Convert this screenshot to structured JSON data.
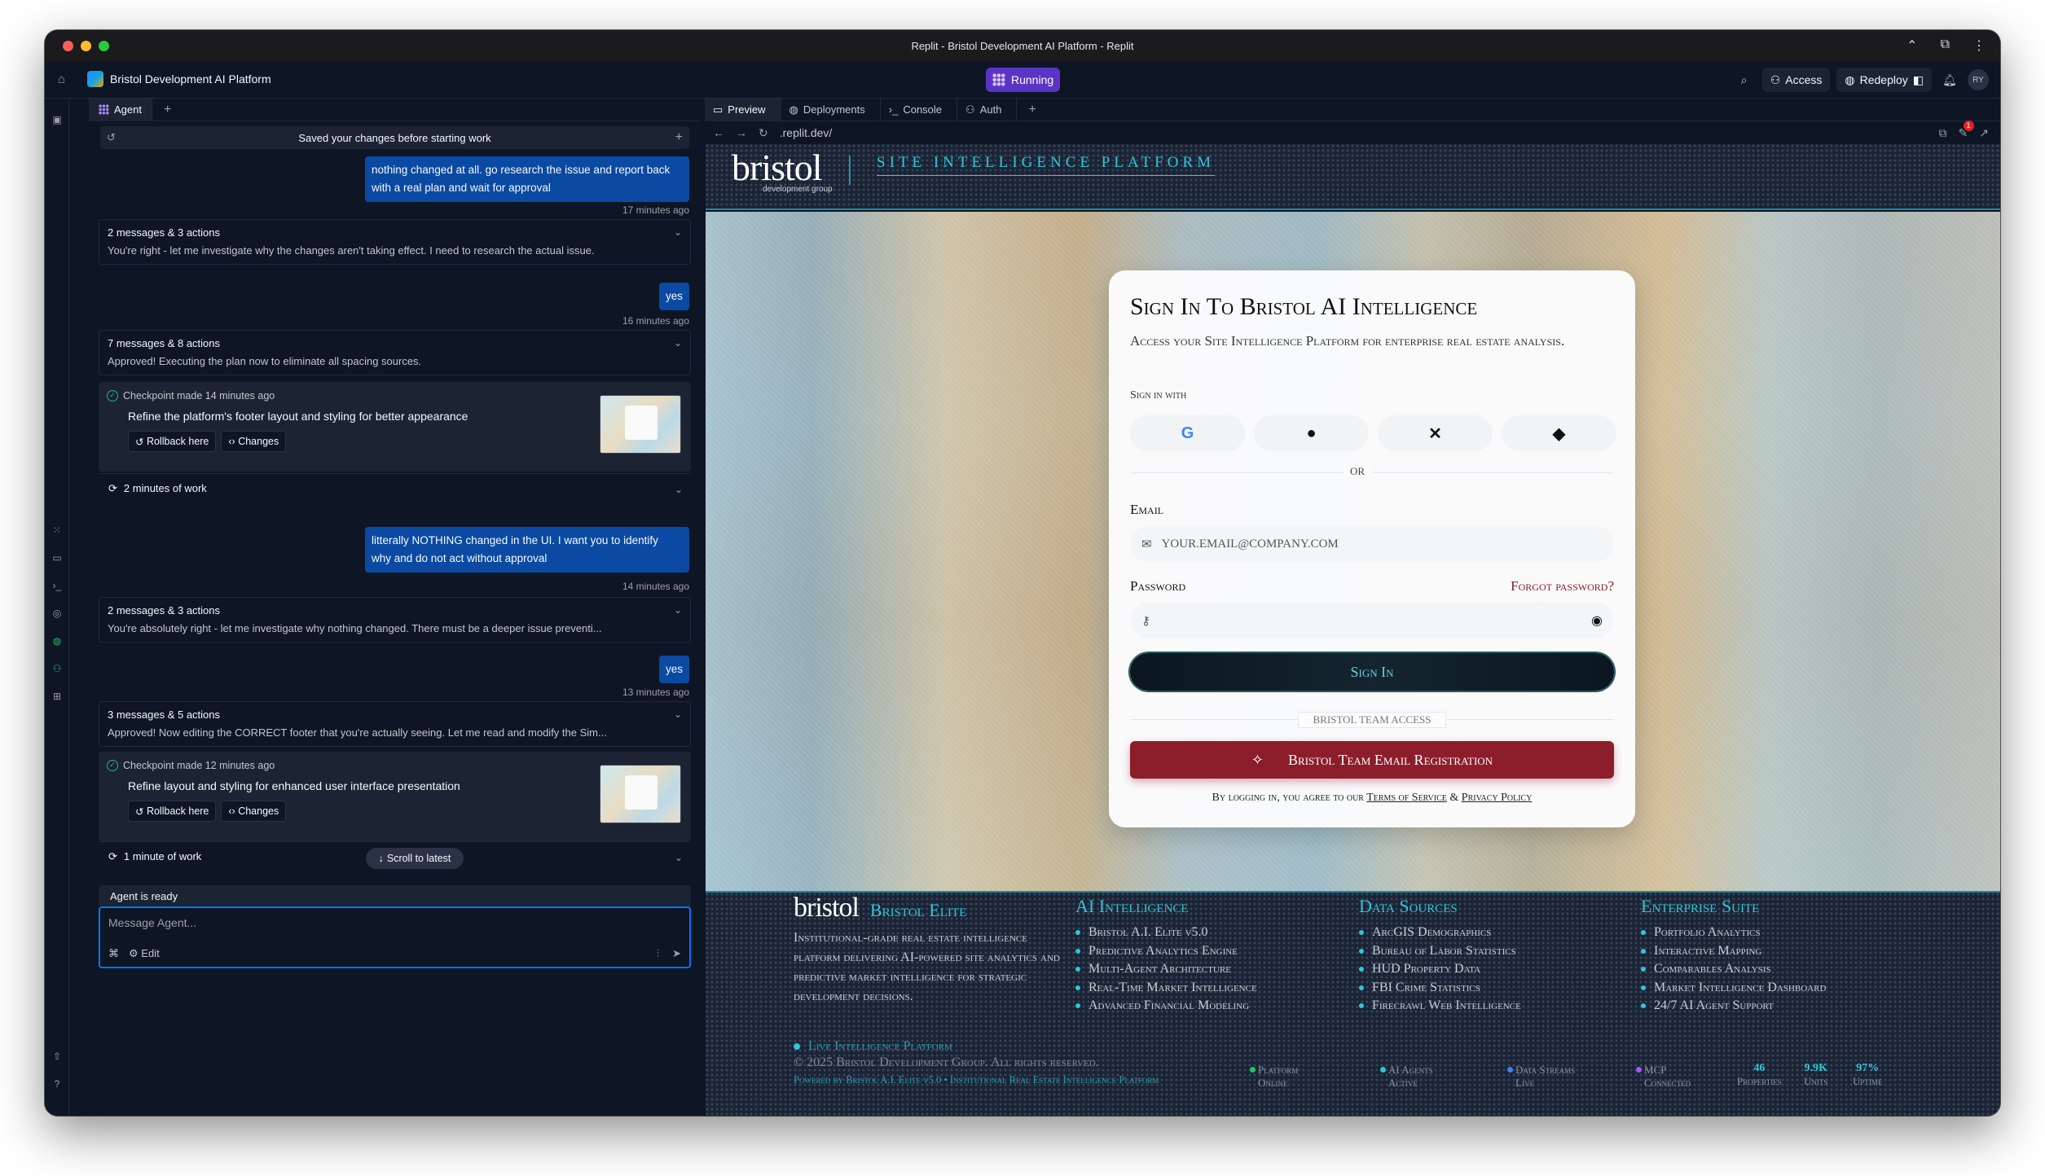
{
  "window": {
    "title": "Replit - Bristol Development AI Platform - Replit"
  },
  "appbar": {
    "project_name": "Bristol Development AI Platform",
    "running_label": "Running",
    "access_label": "Access",
    "redeploy_label": "Redeploy",
    "avatar_initials": "RY"
  },
  "left_panel": {
    "tab_label": "Agent",
    "saved_banner": "Saved your changes before starting work",
    "messages": [
      {
        "type": "user",
        "lines": [
          "nothing changed at all. go research the issue and report back",
          "with a real plan and wait for approval"
        ],
        "time": "17 minutes ago"
      },
      {
        "type": "group",
        "title": "2 messages & 3 actions",
        "summary": "You're right - let me investigate why the changes aren't taking effect. I need to research the actual issue."
      },
      {
        "type": "user",
        "lines": [
          "yes"
        ],
        "time": "16 minutes ago"
      },
      {
        "type": "group",
        "title": "7 messages & 8 actions",
        "summary": "Approved! Executing the plan now to eliminate all spacing sources."
      },
      {
        "type": "checkpoint",
        "title": "Checkpoint made 14 minutes ago",
        "desc": "Refine the platform's footer layout and styling for better appearance",
        "rollback": "Rollback here",
        "changes": "Changes"
      },
      {
        "type": "work",
        "label": "2 minutes of work"
      },
      {
        "type": "user",
        "lines": [
          "litterally NOTHING changed in the UI. I want you to identify",
          "why and do not act without approval"
        ],
        "time": "14 minutes ago"
      },
      {
        "type": "group",
        "title": "2 messages & 3 actions",
        "summary": "You're absolutely right - let me investigate why nothing changed. There must be a deeper issue preventi..."
      },
      {
        "type": "user",
        "lines": [
          "yes"
        ],
        "time": "13 minutes ago"
      },
      {
        "type": "group",
        "title": "3 messages & 5 actions",
        "summary": "Approved! Now editing the CORRECT footer that you're actually seeing. Let me read and modify the Sim..."
      },
      {
        "type": "checkpoint",
        "title": "Checkpoint made 12 minutes ago",
        "desc": "Refine layout and styling for enhanced user interface presentation",
        "rollback": "Rollback here",
        "changes": "Changes"
      },
      {
        "type": "work",
        "label": "1 minute of work"
      }
    ],
    "scroll_latest": "Scroll to latest",
    "status": "Agent is ready",
    "input_placeholder": "Message Agent...",
    "edit_label": "Edit"
  },
  "right_panel": {
    "tabs": [
      "Preview",
      "Deployments",
      "Console",
      "Auth"
    ],
    "url": ".replit.dev/",
    "notification_count": "1"
  },
  "site": {
    "logo": "bristol",
    "logo_sub": "development group",
    "header_title": "Site Intelligence Platform",
    "card": {
      "title": "Sign In To Bristol AI Intelligence",
      "subtitle": "Access your Site Intelligence Platform for enterprise real estate analysis.",
      "sign_in_with": "Sign in with",
      "or": "OR",
      "email_label": "Email",
      "email_placeholder": "YOUR.EMAIL@COMPANY.COM",
      "password_label": "Password",
      "forgot": "Forgot password?",
      "sign_in_button": "Sign In",
      "team_access": "BRISTOL TEAM ACCESS",
      "register_button": "Bristol Team Email Registration",
      "terms_prefix": "By logging in, you agree to our",
      "terms_link": "Terms of Service",
      "amp": "&",
      "privacy_link": "Privacy Policy"
    },
    "footer": {
      "brand_logo": "bristol",
      "brand_name": "Bristol Elite",
      "brand_desc": "Institutional-grade real estate intelligence platform delivering AI-powered site analytics and predictive market intelligence for strategic development decisions.",
      "cols": [
        {
          "title": "AI Intelligence",
          "items": [
            "Bristol A.I. Elite v5.0",
            "Predictive Analytics Engine",
            "Multi-Agent Architecture",
            "Real-Time Market Intelligence",
            "Advanced Financial Modeling"
          ]
        },
        {
          "title": "Data Sources",
          "items": [
            "ArcGIS Demographics",
            "Bureau of Labor Statistics",
            "HUD Property Data",
            "FBI Crime Statistics",
            "Firecrawl Web Intelligence"
          ]
        },
        {
          "title": "Enterprise Suite",
          "items": [
            "Portfolio Analytics",
            "Interactive Mapping",
            "Comparables Analysis",
            "Market Intelligence Dashboard",
            "24/7 AI Agent Support"
          ]
        }
      ],
      "live": "Live Intelligence Platform",
      "copyright": "© 2025 Bristol Development Group. All rights reserved.",
      "powered": "Powered by Bristol A.I. Elite v5.0 • Institutional Real Estate Intelligence Platform",
      "statuses": [
        {
          "l1": "Platform",
          "l2": "Online",
          "color": "#22c55e"
        },
        {
          "l1": "AI Agents",
          "l2": "Active",
          "color": "#30c6d9"
        },
        {
          "l1": "Data Streams",
          "l2": "Live",
          "color": "#3b82f6"
        },
        {
          "l1": "MCP",
          "l2": "Connected",
          "color": "#a855f7"
        }
      ],
      "metrics": [
        {
          "value": "46",
          "label": "Properties"
        },
        {
          "value": "9.9K",
          "label": "Units"
        },
        {
          "value": "97%",
          "label": "Uptime"
        }
      ]
    }
  }
}
